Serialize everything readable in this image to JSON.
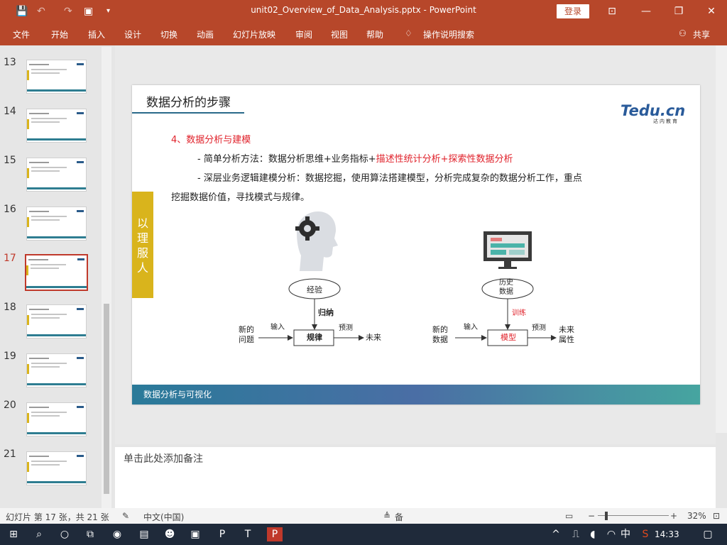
{
  "window": {
    "title": "unit02_Overview_of_Data_Analysis.pptx  -  PowerPoint",
    "login_label": "登录",
    "share_label": "共享"
  },
  "ribbon": {
    "tabs": [
      "文件",
      "开始",
      "插入",
      "设计",
      "切换",
      "动画",
      "幻灯片放映",
      "审阅",
      "视图",
      "帮助",
      "操作说明搜索"
    ]
  },
  "thumbnails": {
    "numbers": [
      "13",
      "14",
      "15",
      "16",
      "17",
      "18",
      "19",
      "20",
      "21"
    ],
    "active": "17"
  },
  "slide": {
    "title": "数据分析的步骤",
    "logo_text": "Tedu.cn",
    "logo_sub": "达内教育",
    "heading": "4、数据分析与建模",
    "line1_prefix": "- 简单分析方法：数据分析思维+业务指标+",
    "line1_highlight": "描述性统计分析+探索性数据分析",
    "line2": "- 深层业务逻辑建模分析：数据挖掘，使用算法搭建模型，分析完成复杂的数据分析工作，重点",
    "line3": "挖掘数据价值，寻找模式与规律。",
    "side_tag": [
      "以",
      "理",
      "服",
      "人"
    ],
    "footer": "数据分析与可视化",
    "diagram_left": {
      "ellipse": "经验",
      "arrow_label": "归纳",
      "input_label": "新的\n问题",
      "input_arrow": "输入",
      "box": "规律",
      "predict": "预测",
      "output": "未来"
    },
    "diagram_right": {
      "ellipse": "历史\n数据",
      "arrow_label": "训练",
      "input_label": "新的\n数据",
      "input_arrow": "输入",
      "box": "模型",
      "predict": "预测",
      "output": "未来\n属性"
    }
  },
  "notes": {
    "placeholder": "单击此处添加备注"
  },
  "status": {
    "slide_info": "幻灯片 第 17 张，共 21 张",
    "language": "中文(中国)",
    "notes_label": "备",
    "zoom": "32%"
  },
  "taskbar": {
    "time": "14:33",
    "ime": "中"
  },
  "colors": {
    "accent": "#b7472a",
    "highlight": "#e0222b",
    "tag_yellow": "#d9b41c",
    "bar_teal": "#2a7a99"
  }
}
